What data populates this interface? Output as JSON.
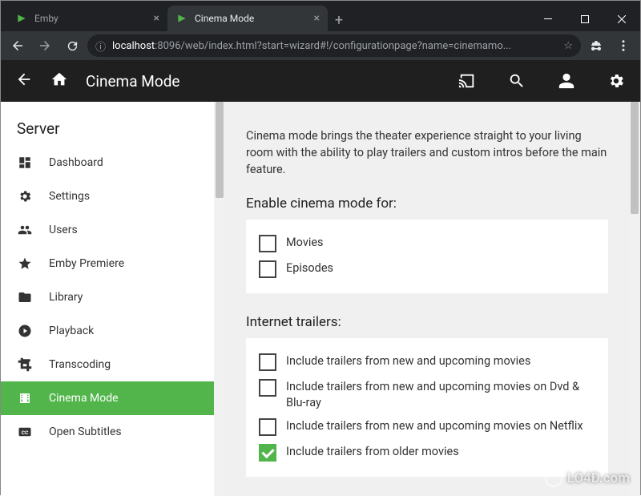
{
  "browser": {
    "tabs": [
      {
        "title": "Emby",
        "active": false
      },
      {
        "title": "Cinema Mode",
        "active": true
      }
    ],
    "url_host": "localhost",
    "url_rest": ":8096/web/index.html?start=wizard#!/configurationpage?name=cinemamo..."
  },
  "app": {
    "title": "Cinema Mode"
  },
  "sidebar": {
    "heading": "Server",
    "items": [
      {
        "label": "Dashboard",
        "icon": "dashboard"
      },
      {
        "label": "Settings",
        "icon": "gear"
      },
      {
        "label": "Users",
        "icon": "people"
      },
      {
        "label": "Emby Premiere",
        "icon": "star"
      },
      {
        "label": "Library",
        "icon": "folder"
      },
      {
        "label": "Playback",
        "icon": "play"
      },
      {
        "label": "Transcoding",
        "icon": "transform"
      },
      {
        "label": "Cinema Mode",
        "icon": "film",
        "active": true
      },
      {
        "label": "Open Subtitles",
        "icon": "cc"
      }
    ]
  },
  "main": {
    "intro": "Cinema mode brings the theater experience straight to your living room with the ability to play trailers and custom intros before the main feature.",
    "section1_title": "Enable cinema mode for:",
    "enable_for": [
      {
        "label": "Movies",
        "checked": false
      },
      {
        "label": "Episodes",
        "checked": false
      }
    ],
    "section2_title": "Internet trailers:",
    "trailers": [
      {
        "label": "Include trailers from new and upcoming movies",
        "checked": false
      },
      {
        "label": "Include trailers from new and upcoming movies on Dvd & Blu-ray",
        "checked": false
      },
      {
        "label": "Include trailers from new and upcoming movies on Netflix",
        "checked": false
      },
      {
        "label": "Include trailers from older movies",
        "checked": true
      }
    ]
  },
  "watermark": "LO4D.com"
}
